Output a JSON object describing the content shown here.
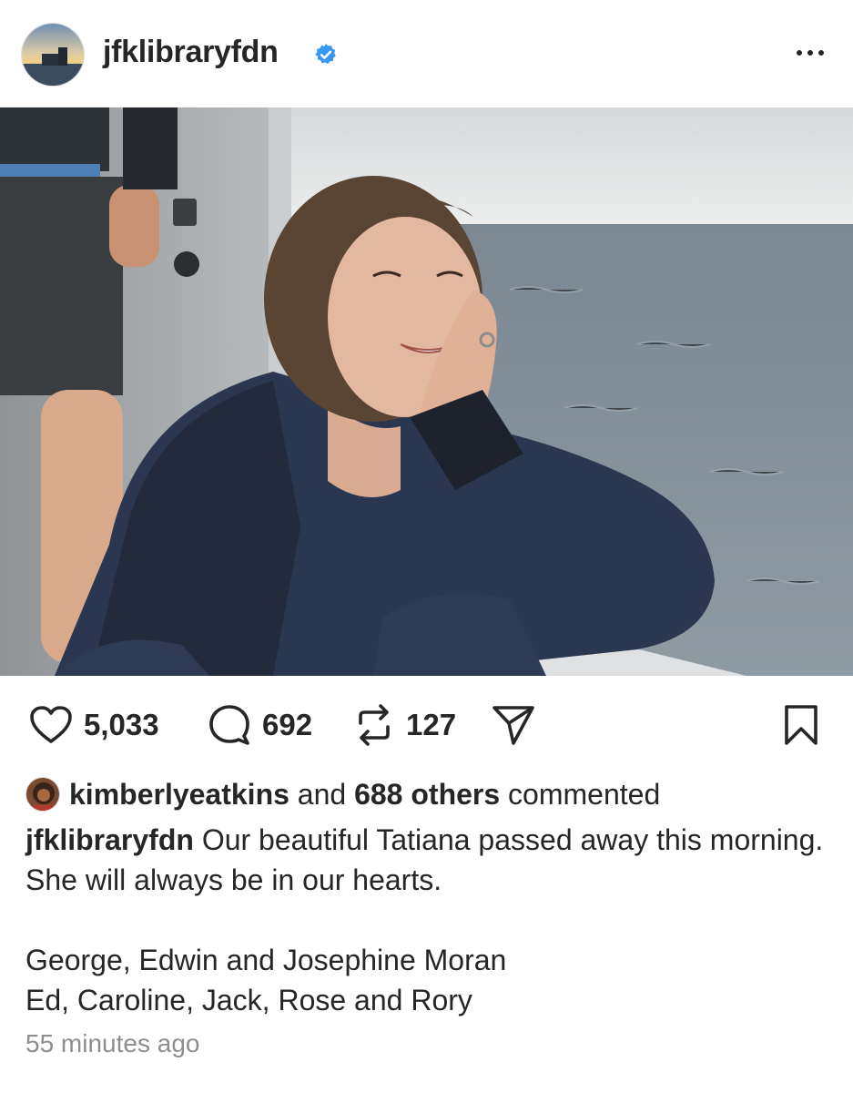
{
  "post": {
    "username": "jfklibraryfdn",
    "verified": true,
    "more_icon": "more-horizontal-icon",
    "image_alt": "Woman smiling on a boat, resting her cheek on her hand, sea in background"
  },
  "actions": {
    "like_icon": "heart-icon",
    "likes": "5,033",
    "comment_icon": "comment-icon",
    "comments": "692",
    "repost_icon": "repost-icon",
    "reposts": "127",
    "share_icon": "send-icon",
    "save_icon": "bookmark-icon"
  },
  "social": {
    "commenter": "kimberlyeatkins",
    "connector": " and ",
    "others": "688 others",
    "suffix": " commented"
  },
  "caption": {
    "username": "jfklibraryfdn",
    "line1": " Our beautiful Tatiana passed away this morning. She will always be in our hearts.",
    "line2": "George, Edwin and Josephine Moran",
    "line3": "Ed, Caroline, Jack, Rose and Rory"
  },
  "meta": {
    "timestamp": "55 minutes ago"
  },
  "colors": {
    "text": "#262626",
    "muted": "#8e8e8e",
    "verified_blue": "#3897f0"
  }
}
